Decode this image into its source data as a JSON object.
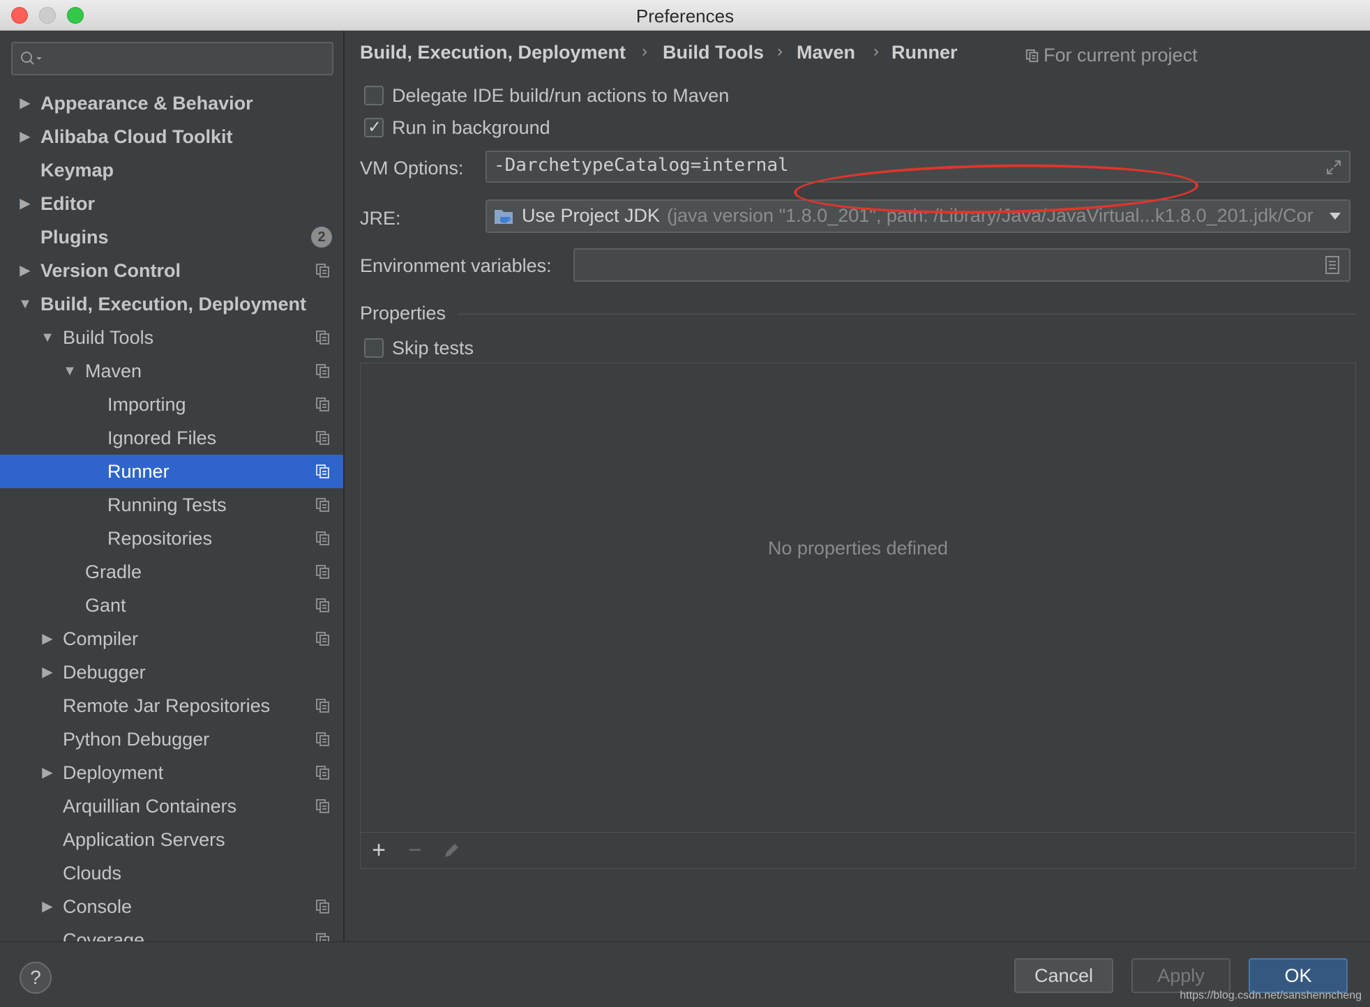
{
  "window": {
    "title": "Preferences"
  },
  "sidebar": {
    "search_placeholder": "",
    "items": [
      {
        "label": "Appearance & Behavior"
      },
      {
        "label": "Alibaba Cloud Toolkit"
      },
      {
        "label": "Keymap"
      },
      {
        "label": "Editor"
      },
      {
        "label": "Plugins",
        "badge": "2"
      },
      {
        "label": "Version Control"
      },
      {
        "label": "Build, Execution, Deployment"
      },
      {
        "label": "Build Tools"
      },
      {
        "label": "Maven"
      },
      {
        "label": "Importing"
      },
      {
        "label": "Ignored Files"
      },
      {
        "label": "Runner"
      },
      {
        "label": "Running Tests"
      },
      {
        "label": "Repositories"
      },
      {
        "label": "Gradle"
      },
      {
        "label": "Gant"
      },
      {
        "label": "Compiler"
      },
      {
        "label": "Debugger"
      },
      {
        "label": "Remote Jar Repositories"
      },
      {
        "label": "Python Debugger"
      },
      {
        "label": "Deployment"
      },
      {
        "label": "Arquillian Containers"
      },
      {
        "label": "Application Servers"
      },
      {
        "label": "Clouds"
      },
      {
        "label": "Console"
      },
      {
        "label": "Coverage"
      }
    ]
  },
  "breadcrumb": [
    "Build, Execution, Deployment",
    "Build Tools",
    "Maven",
    "Runner"
  ],
  "scope_label": "For current project",
  "options": {
    "delegate_label": "Delegate IDE build/run actions to Maven",
    "delegate_checked": false,
    "background_label": "Run in background",
    "background_checked": true
  },
  "vm_options": {
    "label": "VM Options:",
    "value": "-DarchetypeCatalog=internal"
  },
  "jre": {
    "label": "JRE:",
    "selected": "Use Project JDK",
    "detail": "(java version \"1.8.0_201\", path: /Library/Java/JavaVirtual...k1.8.0_201.jdk/Cor"
  },
  "env": {
    "label": "Environment variables:",
    "value": ""
  },
  "properties": {
    "title": "Properties",
    "skip_tests_label": "Skip tests",
    "skip_tests_checked": false,
    "empty_text": "No properties defined",
    "toolbar": {
      "add": "+",
      "remove": "−"
    }
  },
  "footer": {
    "help": "?",
    "cancel": "Cancel",
    "apply": "Apply",
    "ok": "OK",
    "watermark": "https://blog.csdn.net/sanshenncheng"
  },
  "colors": {
    "selection": "#2f65ca",
    "annotation": "#e0352b",
    "ok": "#365880"
  }
}
